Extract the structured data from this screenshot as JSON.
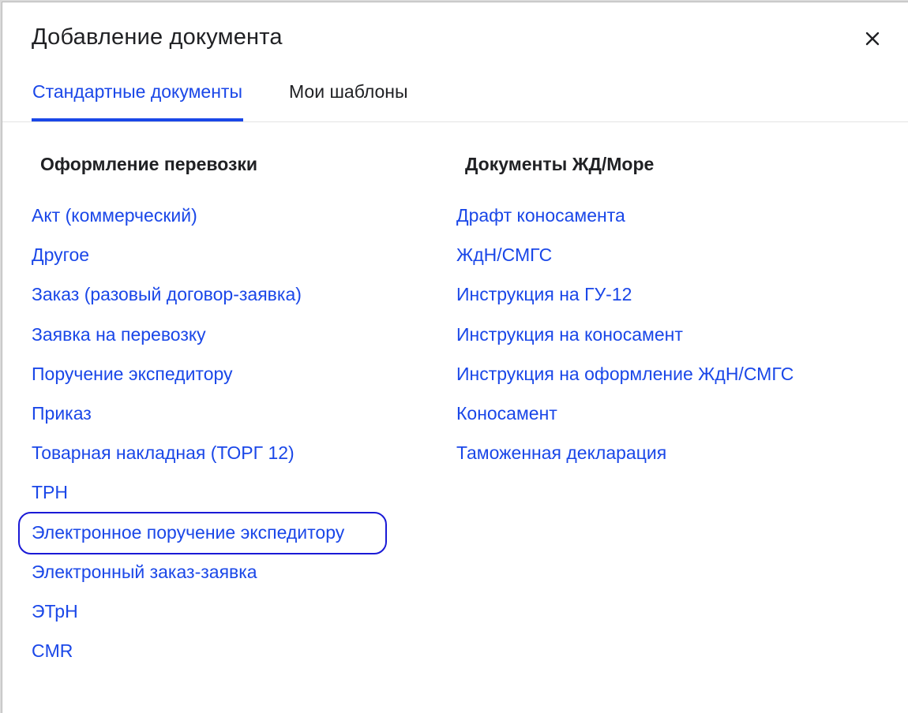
{
  "dialog": {
    "title": "Добавление документа",
    "close_icon": "close-icon"
  },
  "tabs": [
    {
      "label": "Стандартные документы",
      "active": true
    },
    {
      "label": "Мои шаблоны",
      "active": false
    }
  ],
  "columns": {
    "left": {
      "heading": "Оформление перевозки",
      "items": [
        "Акт (коммерческий)",
        "Другое",
        "Заказ (разовый договор-заявка)",
        "Заявка на перевозку",
        "Поручение экспедитору",
        "Приказ",
        "Товарная накладная (ТОРГ 12)",
        "ТРН",
        "Электронное поручение экспедитору",
        "Электронный заказ-заявка",
        "ЭТрН",
        "CMR"
      ],
      "highlighted_item": "Электронное поручение экспедитору"
    },
    "right": {
      "heading": "Документы ЖД/Море",
      "items": [
        "Драфт коносамента",
        "ЖдН/СМГС",
        "Инструкция на ГУ-12",
        "Инструкция на коносамент",
        "Инструкция на оформление ЖдН/СМГС",
        "Коносамент",
        "Таможенная декларация"
      ]
    }
  },
  "colors": {
    "link": "#1a47e8",
    "text": "#202124",
    "highlight_border": "#1a1ad6"
  }
}
